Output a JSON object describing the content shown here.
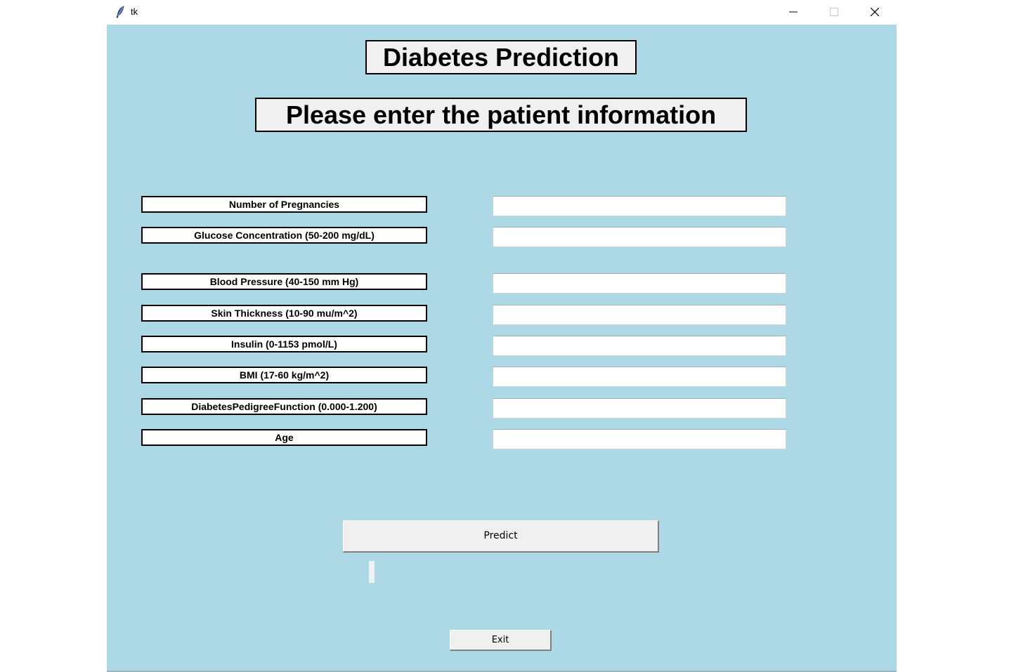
{
  "window": {
    "title": "tk",
    "icon": "feather-icon",
    "controls": {
      "minimize_icon": "minimize-icon",
      "maximize_icon": "maximize-icon",
      "close_icon": "close-icon"
    }
  },
  "colors": {
    "background": "#add8e6",
    "heading_background": "#f0f0f0",
    "label_background": "#ffffff",
    "button_background": "#f0f0f0"
  },
  "header": {
    "title": "Diabetes Prediction",
    "subtitle": "Please enter the patient information"
  },
  "fields": [
    {
      "label": "Number of Pregnancies",
      "value": ""
    },
    {
      "label": "Glucose Concentration (50-200 mg/dL)",
      "value": ""
    },
    {
      "label": "Blood Pressure (40-150 mm Hg)",
      "value": ""
    },
    {
      "label": "Skin Thickness (10-90 mu/m^2)",
      "value": ""
    },
    {
      "label": "Insulin (0-1153 pmol/L)",
      "value": ""
    },
    {
      "label": "BMI (17-60 kg/m^2)",
      "value": ""
    },
    {
      "label": "DiabetesPedigreeFunction (0.000-1.200)",
      "value": ""
    },
    {
      "label": "Age",
      "value": ""
    }
  ],
  "actions": {
    "predict_label": "Predict",
    "result_text": "",
    "exit_label": "Exit"
  }
}
